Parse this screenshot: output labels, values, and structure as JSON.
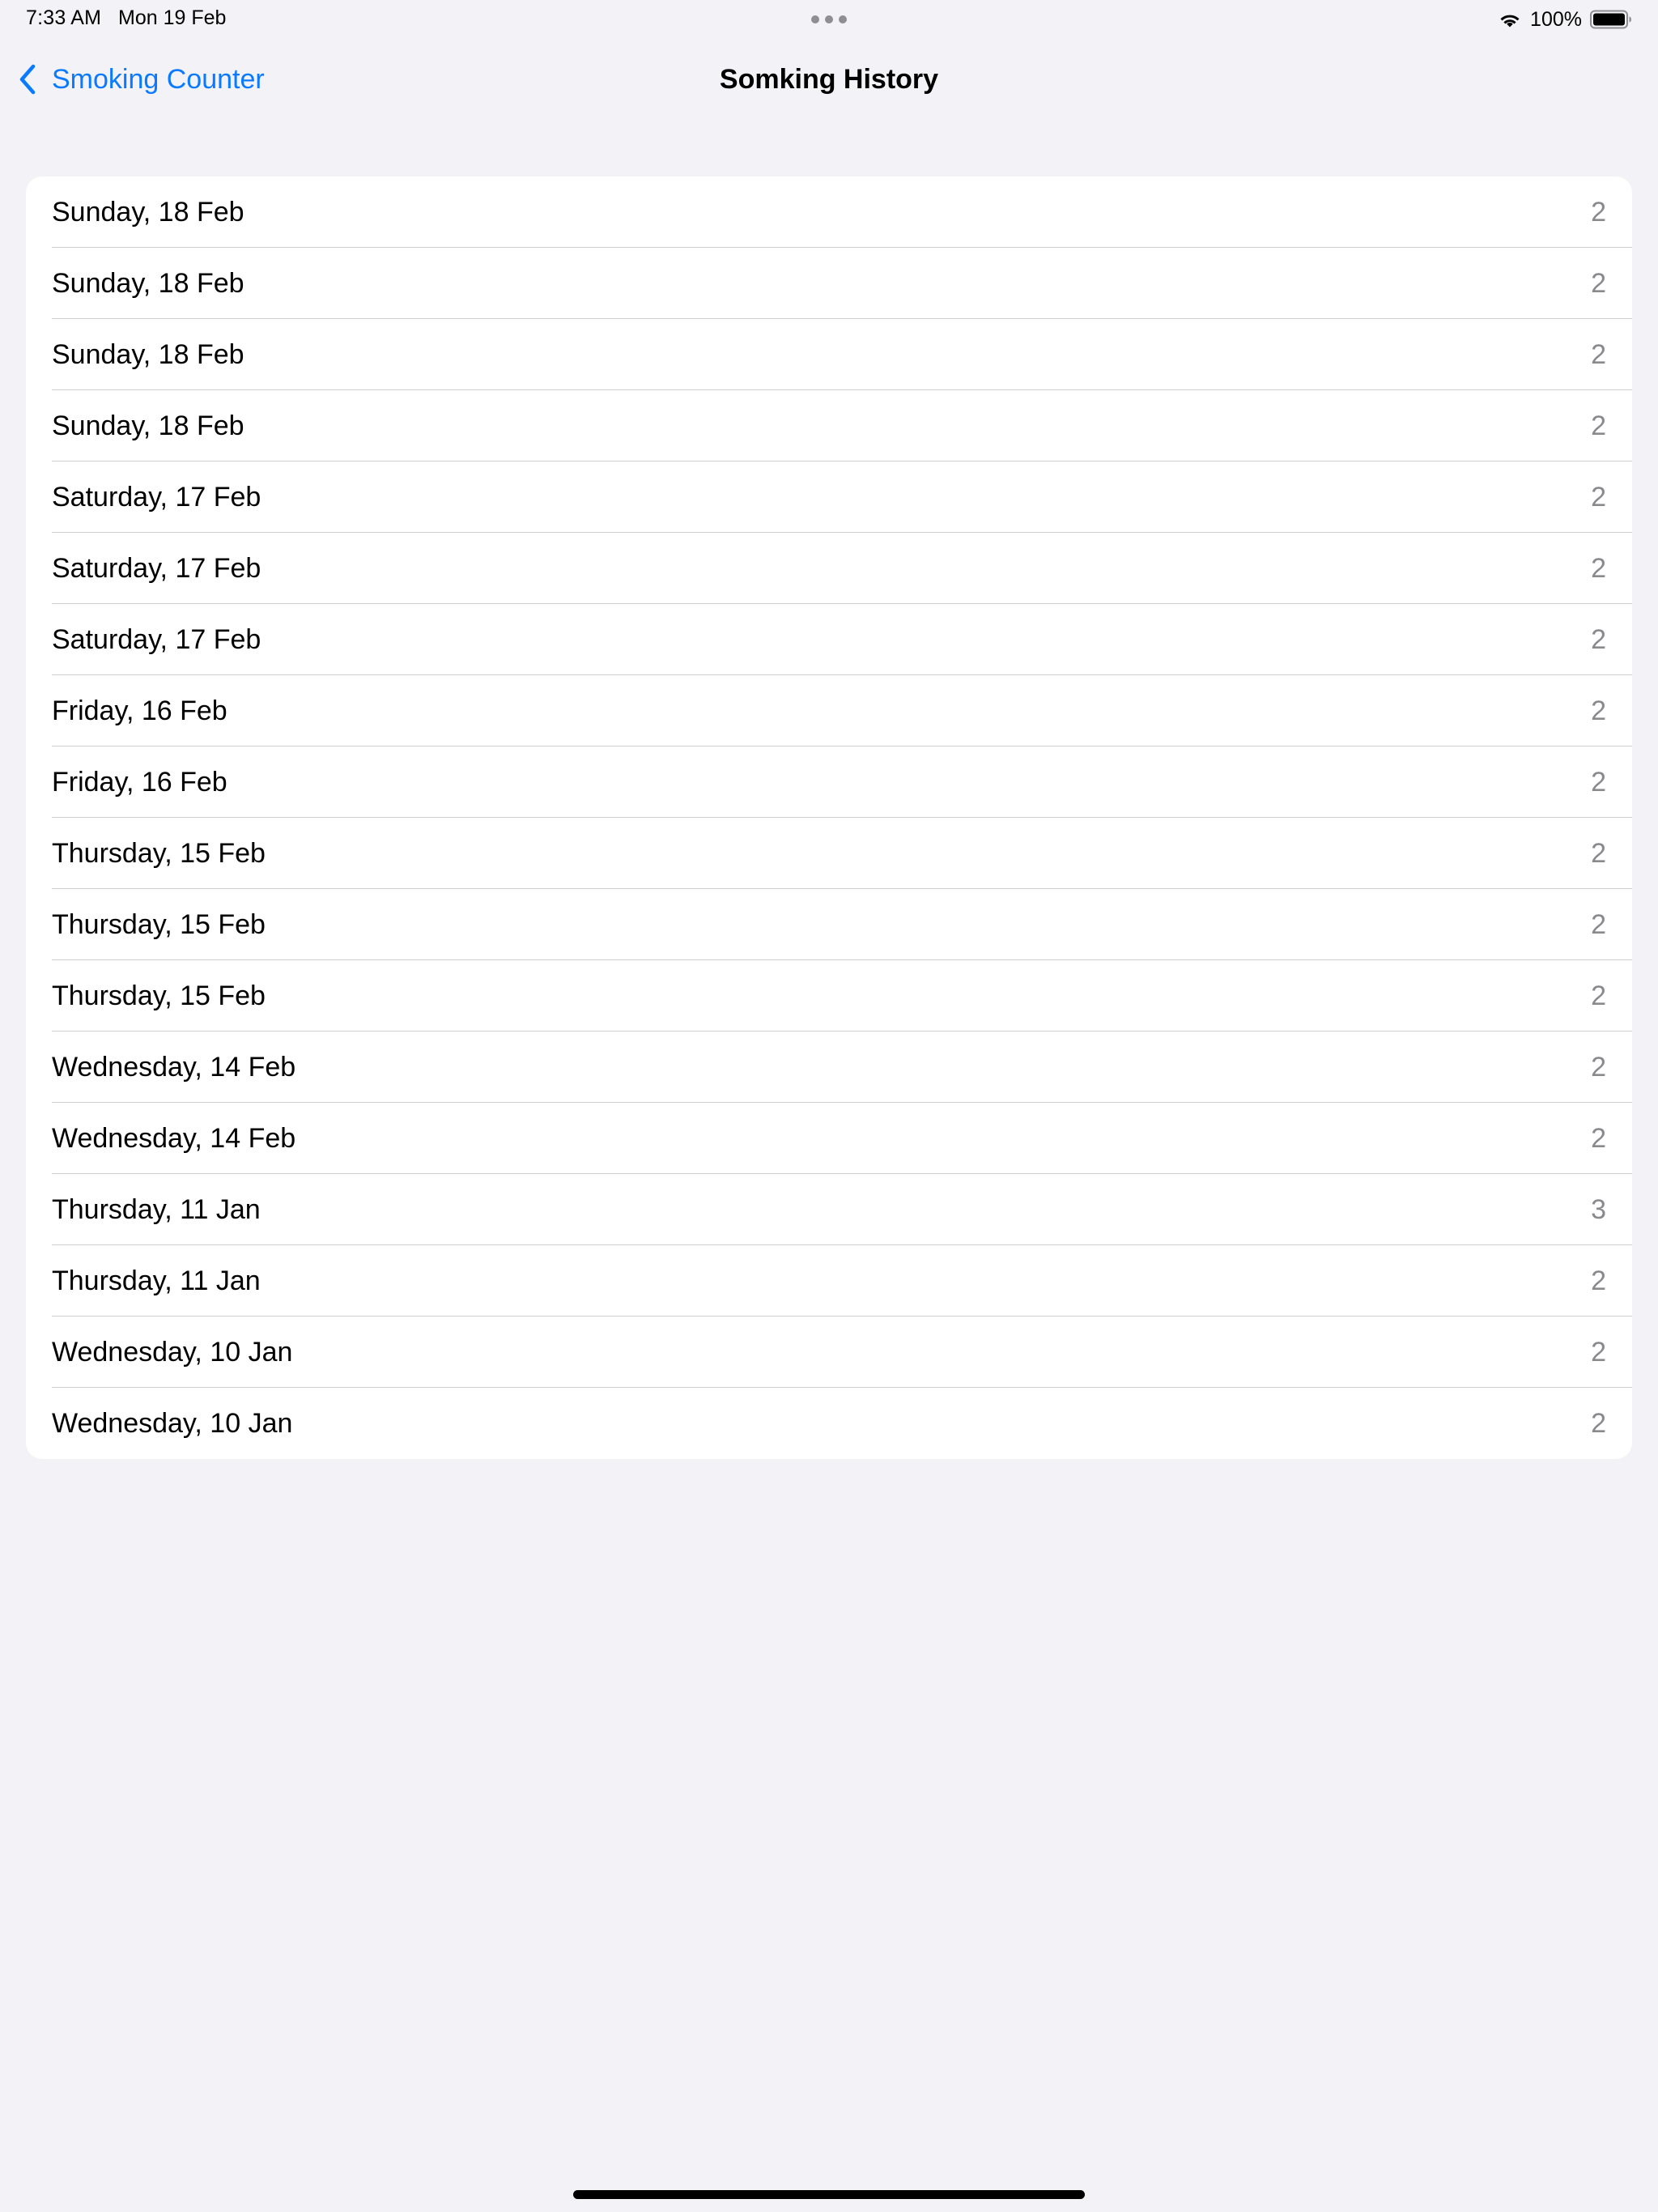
{
  "status_bar": {
    "time": "7:33 AM",
    "date": "Mon 19 Feb",
    "battery_percent": "100%",
    "wifi_icon": "wifi-icon",
    "battery_icon": "battery-full-icon"
  },
  "nav": {
    "back_label": "Smoking Counter",
    "back_icon": "chevron-left-icon",
    "title": "Somking History",
    "accent_color": "#0A7AFF"
  },
  "history": {
    "rows": [
      {
        "label": "Sunday, 18 Feb",
        "value": "2"
      },
      {
        "label": "Sunday, 18 Feb",
        "value": "2"
      },
      {
        "label": "Sunday, 18 Feb",
        "value": "2"
      },
      {
        "label": "Sunday, 18 Feb",
        "value": "2"
      },
      {
        "label": "Saturday, 17 Feb",
        "value": "2"
      },
      {
        "label": "Saturday, 17 Feb",
        "value": "2"
      },
      {
        "label": "Saturday, 17 Feb",
        "value": "2"
      },
      {
        "label": "Friday, 16 Feb",
        "value": "2"
      },
      {
        "label": "Friday, 16 Feb",
        "value": "2"
      },
      {
        "label": "Thursday, 15 Feb",
        "value": "2"
      },
      {
        "label": "Thursday, 15 Feb",
        "value": "2"
      },
      {
        "label": "Thursday, 15 Feb",
        "value": "2"
      },
      {
        "label": "Wednesday, 14 Feb",
        "value": "2"
      },
      {
        "label": "Wednesday, 14 Feb",
        "value": "2"
      },
      {
        "label": "Thursday, 11 Jan",
        "value": "3"
      },
      {
        "label": "Thursday, 11 Jan",
        "value": "2"
      },
      {
        "label": "Wednesday, 10 Jan",
        "value": "2"
      },
      {
        "label": "Wednesday, 10 Jan",
        "value": "2"
      }
    ]
  }
}
